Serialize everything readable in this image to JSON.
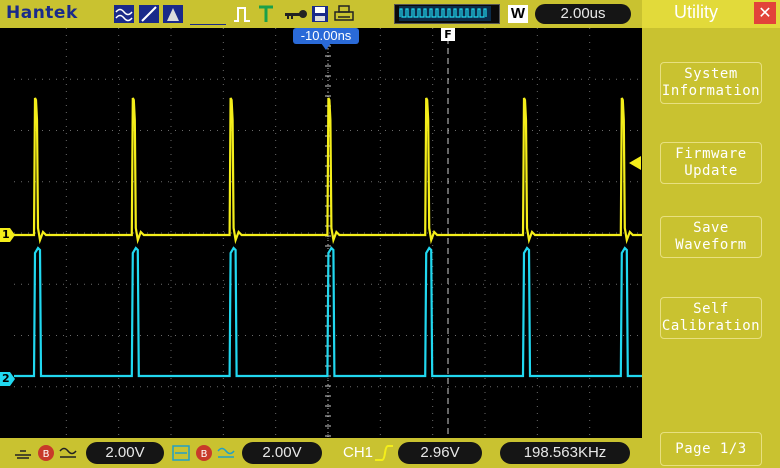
{
  "header": {
    "brand": "Hantek",
    "timebase": "2.00us",
    "window_mode": "W",
    "icons": [
      "wave-display-icon",
      "trigger-slope-icon",
      "cursor-icon",
      "pulse-icon",
      "trigger-T-icon",
      "key-icon",
      "save-disk-icon",
      "printer-icon"
    ]
  },
  "screen": {
    "trigger_offset": "-10.00ns",
    "trigger_marker": "F",
    "ch1_marker": "1",
    "ch2_marker": "2",
    "ch1_color": "#f4ee1a",
    "ch2_color": "#21d8f0"
  },
  "footer": {
    "ch1_scale": "2.00V",
    "ch2_scale": "2.00V",
    "trigger_source": "CH1",
    "trigger_level": "2.96V",
    "frequency": "198.563KHz"
  },
  "side_menu": {
    "title": "Utility",
    "buttons": [
      {
        "label": "System\nInformation"
      },
      {
        "label": "Firmware\nUpdate"
      },
      {
        "label": "Save\nWaveform"
      },
      {
        "label": "Self\nCalibration"
      }
    ],
    "page": "Page 1/3"
  }
}
